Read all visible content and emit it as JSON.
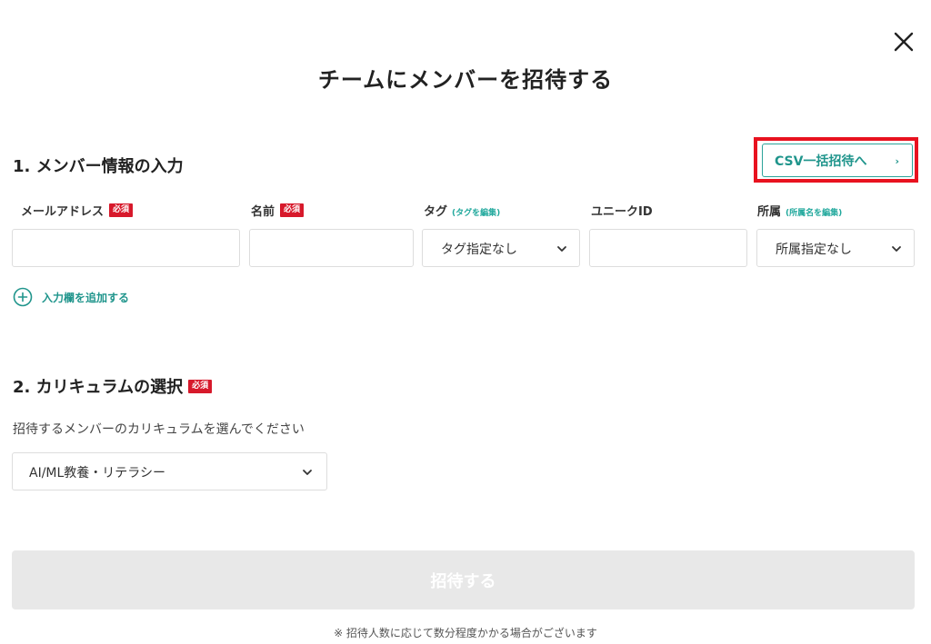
{
  "modal": {
    "title": "チームにメンバーを招待する",
    "close_icon": "close-icon"
  },
  "section1": {
    "heading": "1. メンバー情報の入力",
    "csv_button_label": "CSV一括招待へ",
    "csv_chevron": "›",
    "columns": {
      "email": {
        "label": "メールアドレス",
        "badge": "必須"
      },
      "name": {
        "label": "名前",
        "badge": "必須"
      },
      "tag": {
        "label": "タグ",
        "edit_link": "(タグを編集)",
        "selected": "タグ指定なし"
      },
      "unique_id": {
        "label": "ユニークID"
      },
      "affiliation": {
        "label": "所属",
        "edit_link": "(所属名を編集)",
        "selected": "所属指定なし"
      }
    },
    "add_row_label": "入力欄を追加する"
  },
  "section2": {
    "heading": "2. カリキュラムの選択",
    "badge": "必須",
    "instruction": "招待するメンバーのカリキュラムを選んでください",
    "selected_curriculum": "AI/ML教養・リテラシー"
  },
  "submit": {
    "label": "招待する",
    "enabled": false
  },
  "footnote": "※ 招待人数に応じて数分程度かかる場合がございます",
  "colors": {
    "accent": "#20958c",
    "required_badge": "#d7192b",
    "highlight": "#e8121f",
    "disabled_button": "#e8e8e8"
  }
}
